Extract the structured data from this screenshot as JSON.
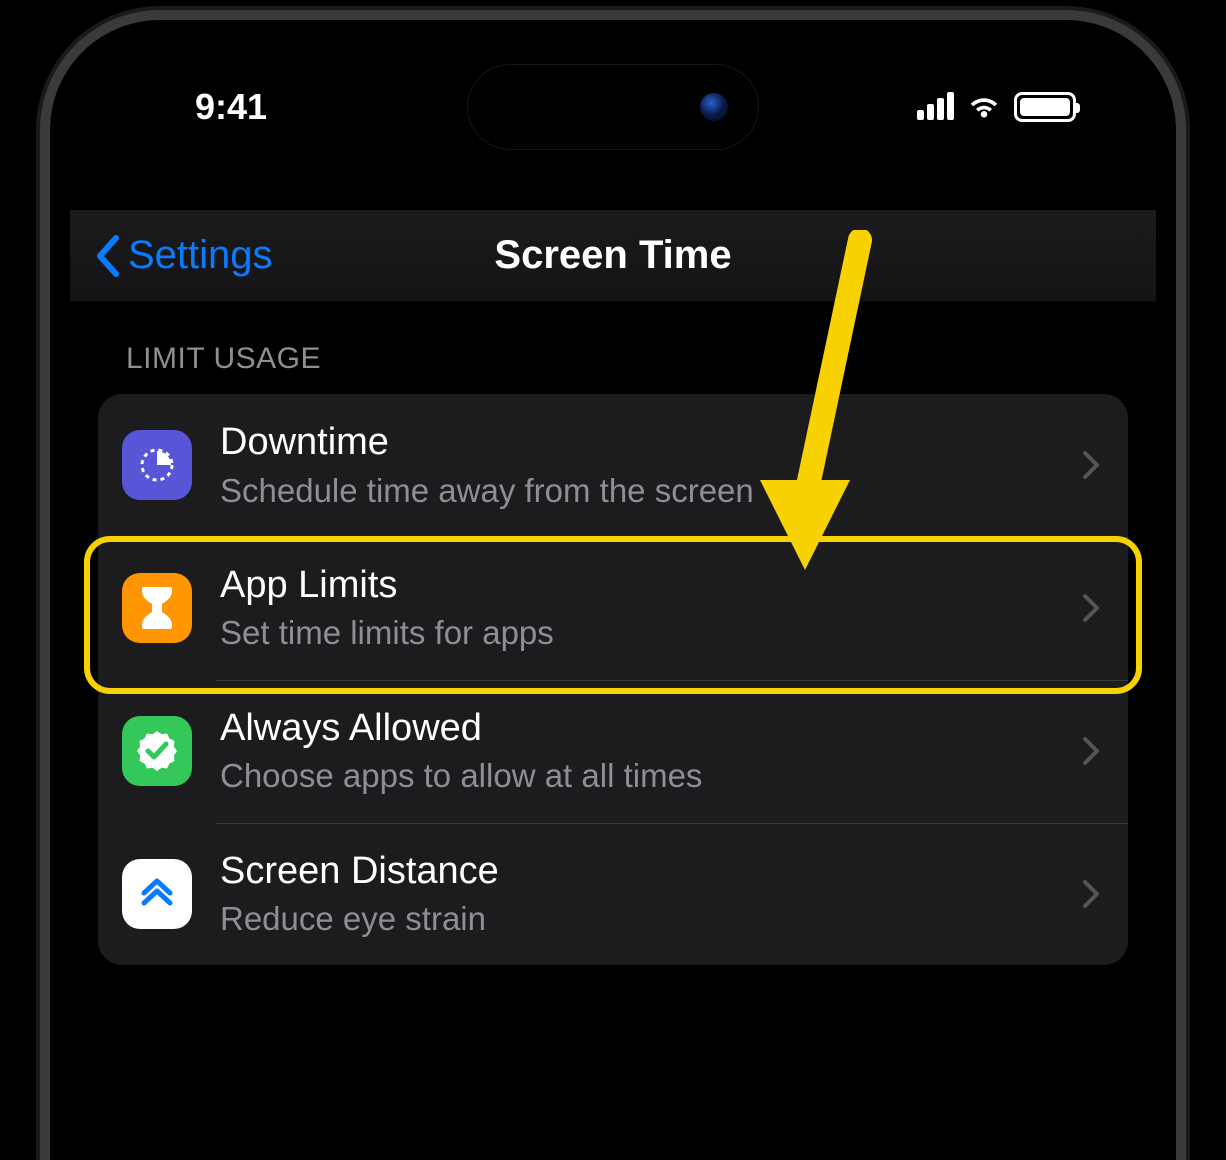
{
  "status": {
    "time": "9:41"
  },
  "nav": {
    "back_label": "Settings",
    "title": "Screen Time"
  },
  "section": {
    "header": "LIMIT USAGE"
  },
  "rows": {
    "downtime": {
      "title": "Downtime",
      "subtitle": "Schedule time away from the screen",
      "icon_color": "#5856d6"
    },
    "app_limits": {
      "title": "App Limits",
      "subtitle": "Set time limits for apps",
      "icon_color": "#ff9500"
    },
    "always_allowed": {
      "title": "Always Allowed",
      "subtitle": "Choose apps to allow at all times",
      "icon_color": "#34c759"
    },
    "screen_distance": {
      "title": "Screen Distance",
      "subtitle": "Reduce eye strain",
      "icon_color": "#ffffff"
    }
  },
  "annotation": {
    "highlight_row": "app_limits",
    "highlight_color": "#f7d100"
  }
}
